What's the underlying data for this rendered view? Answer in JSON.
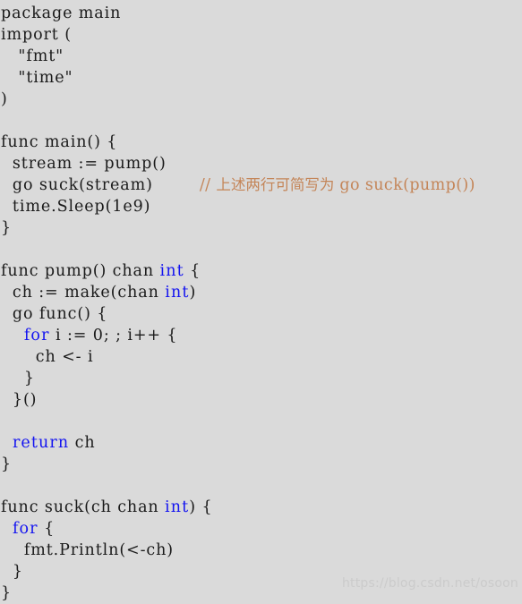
{
  "theme": {
    "background": "#dadada",
    "text_color": "#1a1a1a",
    "keyword_color": "#1414f0",
    "comment_color": "#c48558",
    "watermark_color": "#cbcbcb"
  },
  "code": {
    "language": "go",
    "lines": [
      {
        "n": 1,
        "text": "package main"
      },
      {
        "n": 2,
        "text": "import ("
      },
      {
        "n": 3,
        "text": "   \"fmt\""
      },
      {
        "n": 4,
        "text": "   \"time\""
      },
      {
        "n": 5,
        "text": ")"
      },
      {
        "n": 6,
        "text": ""
      },
      {
        "n": 7,
        "text": "func main() {"
      },
      {
        "n": 8,
        "text": "  stream := pump()"
      },
      {
        "n": 9,
        "text": "  go suck(stream)"
      },
      {
        "n": 10,
        "text": "  time.Sleep(1e9)"
      },
      {
        "n": 11,
        "text": "}"
      },
      {
        "n": 12,
        "text": ""
      },
      {
        "n": 13,
        "text": "func pump() chan int {"
      },
      {
        "n": 14,
        "text": "  ch := make(chan int)"
      },
      {
        "n": 15,
        "text": "  go func() {"
      },
      {
        "n": 16,
        "text": "    for i := 0; ; i++ {"
      },
      {
        "n": 17,
        "text": "      ch <- i"
      },
      {
        "n": 18,
        "text": "    }"
      },
      {
        "n": 19,
        "text": "  }()"
      },
      {
        "n": 20,
        "text": ""
      },
      {
        "n": 21,
        "text": "  return ch"
      },
      {
        "n": 22,
        "text": "}"
      },
      {
        "n": 23,
        "text": ""
      },
      {
        "n": 24,
        "text": "func suck(ch chan int) {"
      },
      {
        "n": 25,
        "text": "  for {"
      },
      {
        "n": 26,
        "text": "    fmt.Println(<-ch)"
      },
      {
        "n": 27,
        "text": "  }"
      },
      {
        "n": 28,
        "text": "}"
      }
    ],
    "tokens": {
      "line1": "package main",
      "line2": "import (",
      "line3": "   \"fmt\"",
      "line4": "   \"time\"",
      "line5": ")",
      "line7": "func main() {",
      "line8": "  stream := pump()",
      "line9_code": "  go suck(stream)",
      "line9_comment_slashes": "// ",
      "line9_comment_cjk": "上述两行可简写为",
      "line9_comment_tail": " go suck(pump())",
      "line10": "  time.Sleep(1e9)",
      "line11": "}",
      "line13_a": "func pump() chan ",
      "line13_kw": "int",
      "line13_b": " {",
      "line14_a": "  ch := make(chan ",
      "line14_kw": "int",
      "line14_b": ")",
      "line15": "  go func() {",
      "line16_indent": "    ",
      "line16_kw": "for",
      "line16_b": " i := 0; ; i++ {",
      "line17": "      ch <- i",
      "line18": "    }",
      "line19": "  }()",
      "line21_indent": "  ",
      "line21_kw": "return",
      "line21_b": " ch",
      "line22": "}",
      "line24_a": "func suck(ch chan ",
      "line24_kw": "int",
      "line24_b": ") {",
      "line25_indent": "  ",
      "line25_kw": "for",
      "line25_b": " {",
      "line26": "    fmt.Println(<-ch)",
      "line27": "  }",
      "line28": "}"
    }
  },
  "watermark": {
    "text": "https://blog.csdn.net/osoon"
  }
}
